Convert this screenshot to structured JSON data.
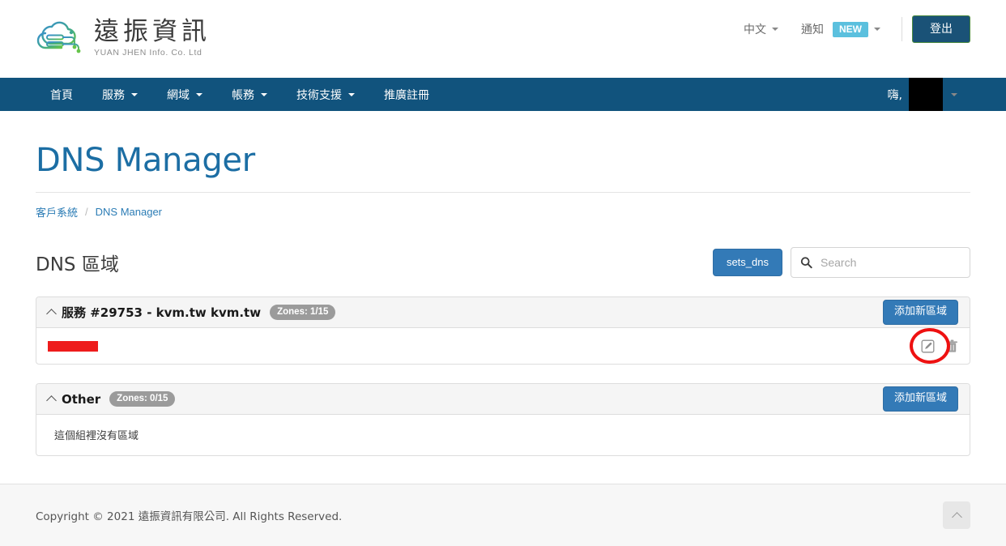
{
  "header": {
    "brand": {
      "cn_name": "遠振資訊",
      "en_name": "YUAN JHEN Info. Co. Ltd",
      "logo_icon": "cloud-network-logo"
    },
    "language_label": "中文",
    "notification_label": "通知",
    "notification_badge": "NEW",
    "logout_label": "登出"
  },
  "nav": {
    "items": [
      {
        "label": "首頁",
        "has_caret": false
      },
      {
        "label": "服務",
        "has_caret": true
      },
      {
        "label": "網域",
        "has_caret": true
      },
      {
        "label": "帳務",
        "has_caret": true
      },
      {
        "label": "技術支援",
        "has_caret": true
      },
      {
        "label": "推廣註冊",
        "has_caret": false
      }
    ],
    "user_greeting": "嗨,",
    "user_name_redacted": true
  },
  "page": {
    "title": "DNS Manager",
    "breadcrumb": [
      {
        "label": "客戶系統",
        "link": true
      },
      {
        "label": "DNS Manager",
        "link": true
      }
    ]
  },
  "section": {
    "title": "DNS 區域",
    "sets_dns_button": "sets_dns",
    "search_placeholder": "Search",
    "search_value": "",
    "search_icon": "search-icon"
  },
  "panels": [
    {
      "title": "服務 #29753 - kvm.tw kvm.tw",
      "badge": "Zones: 1/15",
      "add_zone_button": "添加新區域",
      "collapse_icon": "chevron-up-icon",
      "rows": [
        {
          "name_redacted": true,
          "edit_icon": "edit-pencil-icon",
          "delete_icon": "trash-icon",
          "highlighted": true
        }
      ],
      "empty_message": null
    },
    {
      "title": "Other",
      "badge": "Zones: 0/15",
      "add_zone_button": "添加新區域",
      "collapse_icon": "chevron-up-icon",
      "rows": [],
      "empty_message": "這個組裡沒有區域"
    }
  ],
  "footer": {
    "copyright": "Copyright © 2021 遠振資訊有限公司. All Rights Reserved.",
    "back_to_top_icon": "chevron-up-icon"
  },
  "colors": {
    "navbar": "#11537d",
    "title": "#1c6ea4",
    "primary_button": "#337ab7",
    "badge_new": "#5bc0de",
    "zone_badge": "#9b9b9b",
    "annotation": "#ee1111",
    "redaction": "#ee1c1c"
  }
}
